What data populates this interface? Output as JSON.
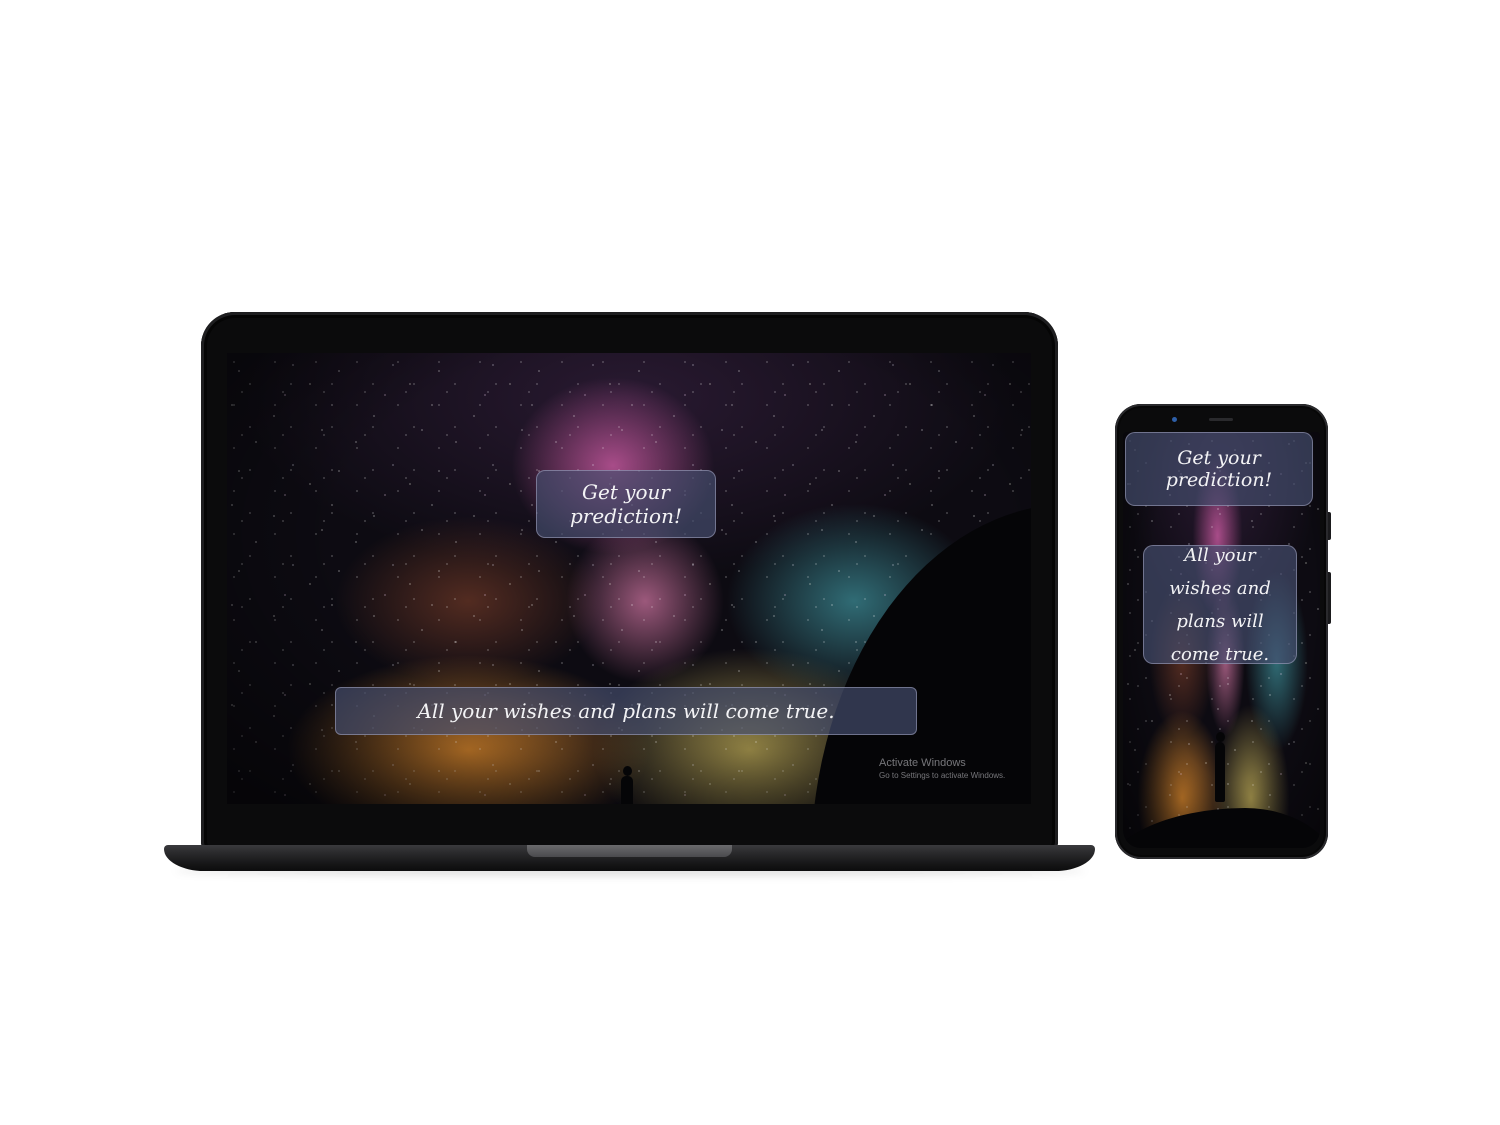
{
  "app": {
    "cta_label": "Get your prediction!",
    "prediction_text": "All your wishes and plans will come true."
  },
  "phone": {
    "prediction_text": "All your wishes and plans will come true."
  },
  "watermark": {
    "line1": "Activate Windows",
    "line2": "Go to Settings to activate Windows."
  },
  "colors": {
    "button_fill": "#464e6e",
    "button_text": "#f3f3f5",
    "device_frame": "#0b0b0c",
    "sky_base": "#0d0b12"
  }
}
